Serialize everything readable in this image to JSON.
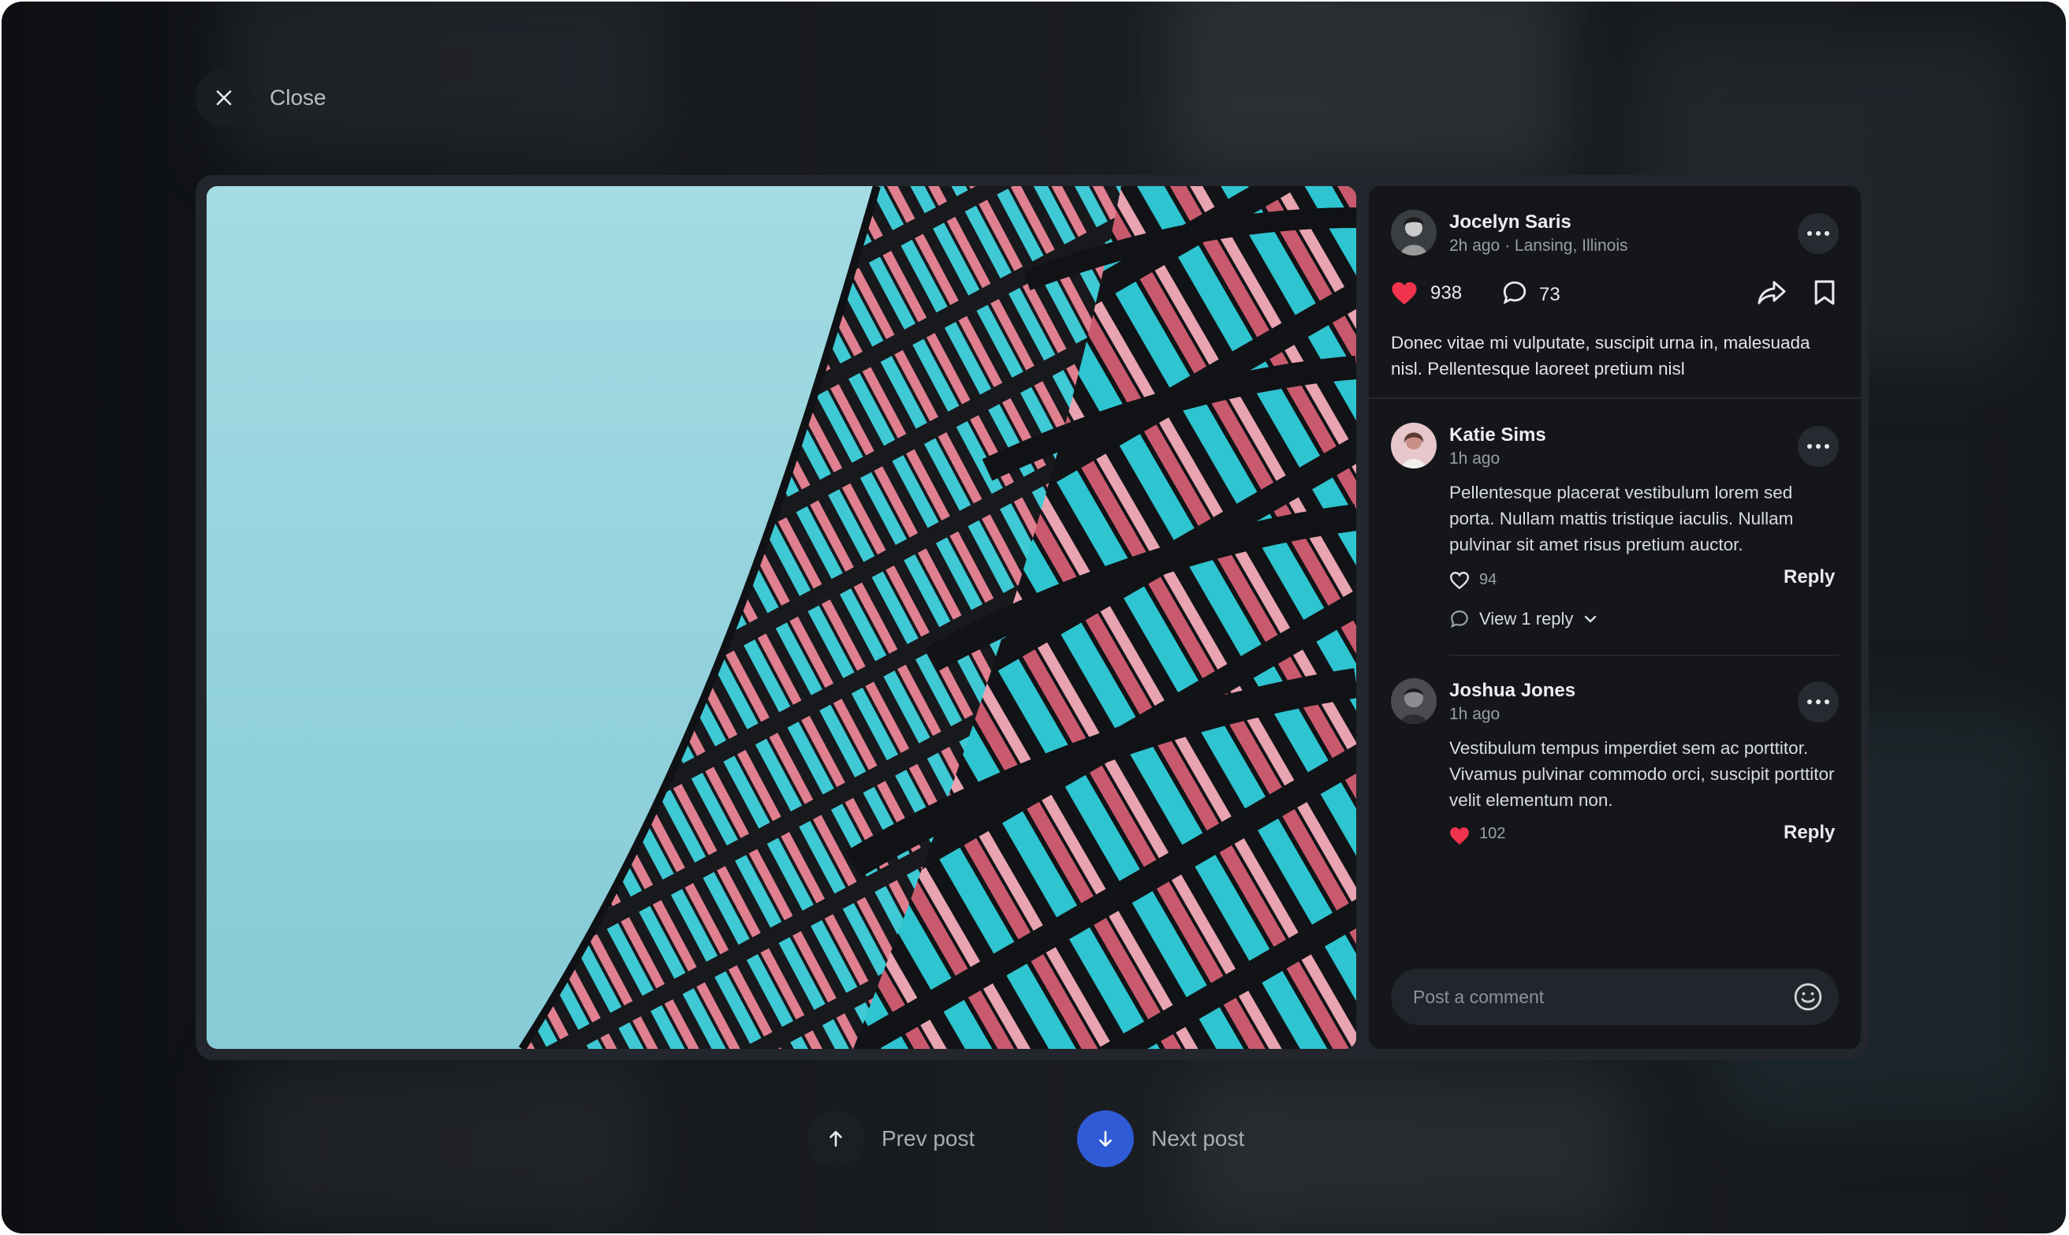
{
  "close": {
    "label": "Close"
  },
  "post": {
    "author": "Jocelyn Saris",
    "time": "2h ago",
    "location": "Lansing, Illinois",
    "likes": "938",
    "comments": "73",
    "caption": "Donec vitae mi vulputate, suscipit urna in, malesuada nisl. Pellentesque laoreet pretium nisl"
  },
  "comments": [
    {
      "author": "Katie Sims",
      "time": "1h ago",
      "text": "Pellentesque placerat vestibulum lorem sed porta. Nullam mattis tristique iaculis. Nullam pulvinar sit amet risus pretium auctor.",
      "likes": "94",
      "reply_label": "Reply",
      "view_replies": "View 1 reply"
    },
    {
      "author": "Joshua Jones",
      "time": "1h ago",
      "text": "Vestibulum tempus imperdiet sem ac porttitor. Vivamus pulvinar commodo orci, suscipit porttitor velit elementum non.",
      "likes": "102",
      "reply_label": "Reply"
    }
  ],
  "comment_input": {
    "placeholder": "Post a comment"
  },
  "nav": {
    "prev_label": "Prev post",
    "next_label": "Next post"
  },
  "colors": {
    "accent": "#2f5bd6",
    "like": "#f0344e",
    "panel": "#14161a",
    "modal": "#23262c"
  }
}
